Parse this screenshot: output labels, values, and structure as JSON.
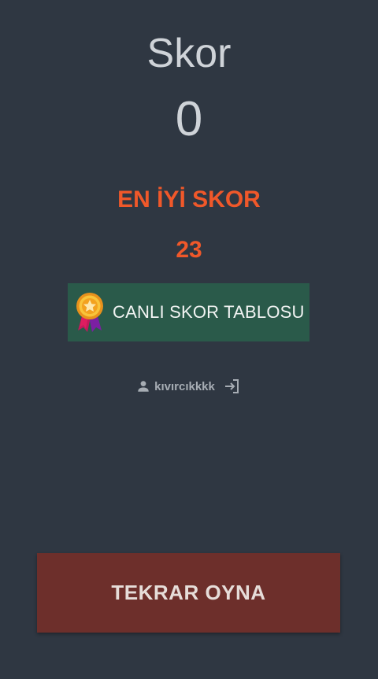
{
  "score": {
    "label": "Skor",
    "value": "0"
  },
  "best_score": {
    "label": "EN İYİ SKOR",
    "value": "23"
  },
  "leaderboard_button": {
    "label": "CANLI SKOR TABLOSU",
    "icon": "medal-icon"
  },
  "user": {
    "icon": "person-icon",
    "username": "kıvırcıkkkk",
    "logout_icon": "logout-icon"
  },
  "replay_button": {
    "label": "TEKRAR OYNA"
  },
  "colors": {
    "background": "#2f3742",
    "accent_orange": "#f0582a",
    "leaderboard_green": "#2a5a4a",
    "replay_red": "#6d2f2b"
  }
}
